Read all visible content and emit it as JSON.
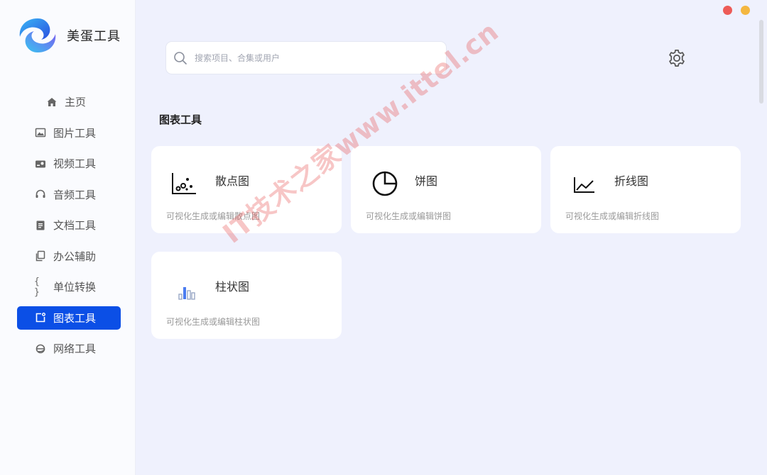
{
  "app": {
    "name": "美蛋工具"
  },
  "sidebar": {
    "items": [
      {
        "label": "主页",
        "icon": "home-icon",
        "active": false
      },
      {
        "label": "图片工具",
        "icon": "image-icon",
        "active": false
      },
      {
        "label": "视频工具",
        "icon": "video-icon",
        "active": false
      },
      {
        "label": "音频工具",
        "icon": "headphones-icon",
        "active": false
      },
      {
        "label": "文档工具",
        "icon": "document-icon",
        "active": false
      },
      {
        "label": "办公辅助",
        "icon": "copy-icon",
        "active": false
      },
      {
        "label": "单位转换",
        "icon": "braces-icon",
        "active": false
      },
      {
        "label": "图表工具",
        "icon": "chart-tool-icon",
        "active": true
      },
      {
        "label": "网络工具",
        "icon": "globe-icon",
        "active": false
      }
    ]
  },
  "search": {
    "placeholder": "搜索项目、合集或用户",
    "value": ""
  },
  "section": {
    "title": "图表工具"
  },
  "cards": [
    {
      "title": "散点图",
      "desc": "可视化生成或编辑散点图",
      "icon": "scatter-chart-icon"
    },
    {
      "title": "饼图",
      "desc": "可视化生成或编辑饼图",
      "icon": "pie-chart-icon"
    },
    {
      "title": "折线图",
      "desc": "可视化生成或编辑折线图",
      "icon": "line-chart-icon"
    },
    {
      "title": "柱状图",
      "desc": "可视化生成或编辑柱状图",
      "icon": "bar-chart-icon"
    }
  ],
  "watermark": "IT技术之家www.ittel.cn",
  "colors": {
    "accent": "#0b4fe6",
    "background": "#eff1fd",
    "close": "#ed5b57",
    "minimize": "#f4b740"
  }
}
